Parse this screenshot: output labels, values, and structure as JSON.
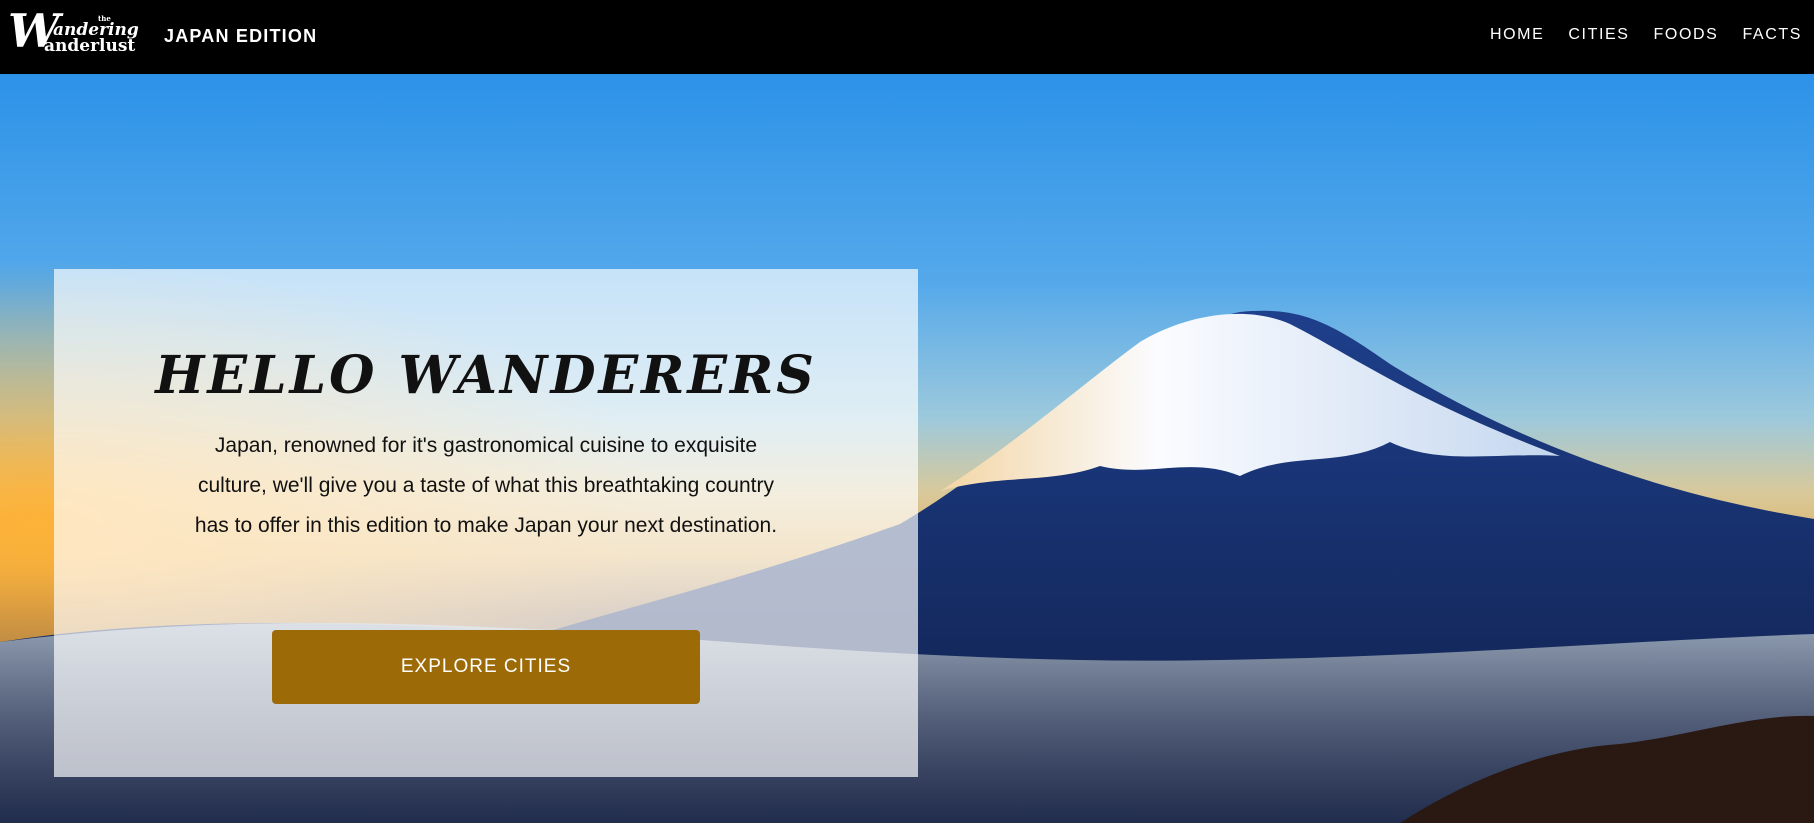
{
  "header": {
    "logo": {
      "small_word": "the",
      "big_letter": "W",
      "line1": "andering",
      "line2": "anderlust"
    },
    "edition": "JAPAN EDITION",
    "nav": [
      {
        "label": "HOME"
      },
      {
        "label": "CITIES"
      },
      {
        "label": "FOODS"
      },
      {
        "label": "FACTS"
      }
    ]
  },
  "hero": {
    "background": "mount-fuji-sunrise-photo",
    "title": "HELLO WANDERERS",
    "body": "Japan, renowned for it's gastronomical cuisine to exquisite culture, we'll give you a taste of what this breathtaking country has to offer in this edition to make Japan your next destination.",
    "cta_label": "EXPLORE CITIES",
    "cta_color": "#9c6b08"
  }
}
